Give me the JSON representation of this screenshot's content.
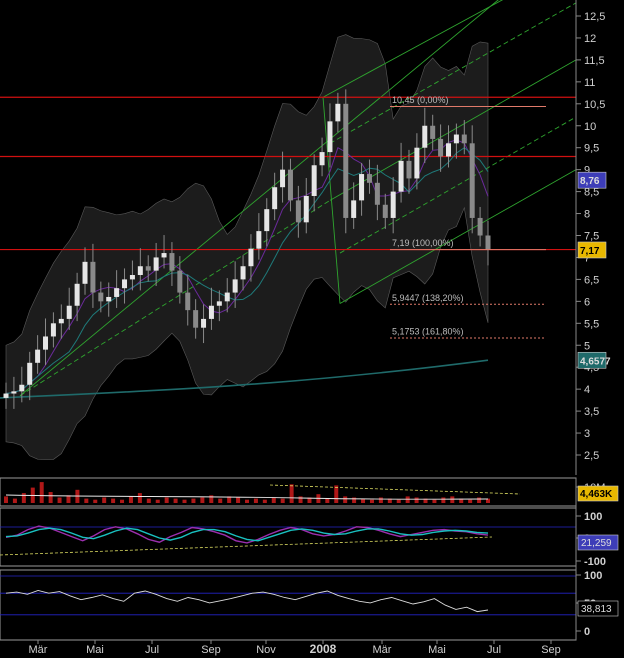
{
  "colors": {
    "background": "#000000",
    "grid": "#2a2a2a",
    "candle_up": "#e6e6e6",
    "candle_down": "#8a8a8a",
    "band_fill": "#1c1c1c",
    "hline": "#d11010",
    "channel": "#2fa52f",
    "fib_label": "#bdbdbd",
    "fib_line": "#e07a6a",
    "volume_bar": "#b01818",
    "volume_line": "#e8e8e8",
    "stoch_k": "#9b2fae",
    "stoch_d": "#19c0c0",
    "rsi_line": "#dcdcdc",
    "ref_line": "#2424c8",
    "axis_text": "#d0d0d0"
  },
  "chart_data": [
    {
      "type": "candlestick",
      "panel": "price",
      "x_axis": {
        "labels": [
          "Mär",
          "Mai",
          "Jul",
          "Sep",
          "Nov",
          "2008",
          "Mär",
          "Mai",
          "Jul",
          "Sep"
        ],
        "bold": [
          "2008"
        ]
      },
      "y_axis": {
        "ticks": [
          "12,5",
          "12",
          "11,5",
          "11",
          "10,5",
          "10",
          "9,5",
          "9",
          "8,5",
          "8",
          "7,5",
          "7",
          "6,5",
          "6",
          "5,5",
          "5",
          "4,5",
          "4",
          "3,5",
          "3",
          "2,5"
        ],
        "range": [
          2.2,
          12.8
        ]
      },
      "grid": false,
      "overlays": [
        "bollinger_bands",
        "moving_average_short",
        "moving_average_mid",
        "moving_average_long",
        "pitchfork_channel"
      ],
      "candles_close": [
        3.9,
        3.95,
        4.1,
        4.6,
        4.9,
        5.2,
        5.5,
        5.6,
        5.9,
        6.4,
        6.9,
        6.2,
        6.0,
        6.1,
        6.3,
        6.5,
        6.6,
        6.8,
        6.7,
        7.0,
        7.1,
        6.7,
        6.2,
        5.8,
        5.4,
        5.6,
        5.9,
        6.0,
        6.2,
        6.5,
        6.8,
        7.2,
        7.6,
        8.1,
        8.6,
        9.0,
        8.3,
        7.8,
        8.4,
        9.1,
        9.4,
        10.1,
        10.5,
        7.9,
        8.3,
        8.9,
        8.7,
        8.2,
        7.9,
        8.5,
        9.2,
        8.8,
        9.5,
        10.0,
        9.7,
        9.3,
        9.6,
        9.8,
        9.6,
        7.9,
        7.5,
        7.17
      ],
      "hlines": [
        10.65,
        9.3,
        7.18
      ],
      "fib_levels": [
        {
          "label": "10,45 (0,00%)",
          "value": 10.45
        },
        {
          "label": "7,19 (100,00%)",
          "value": 7.19
        },
        {
          "label": "5,9447 (138,20%)",
          "value": 5.9447
        },
        {
          "label": "5,1753 (161,80%)",
          "value": 5.1753
        }
      ],
      "badges": [
        {
          "text": "8,76",
          "value": 8.76,
          "color": "#3d3db8"
        },
        {
          "text": "7,17",
          "value": 7.17,
          "color": "#e8b800"
        },
        {
          "text": "4,6577",
          "value": 4.6577,
          "color": "#1f6a6a"
        }
      ]
    },
    {
      "type": "bar",
      "panel": "volume",
      "badge": {
        "text": "4,463K",
        "color": "#e8b800"
      },
      "y_ticks": [
        "10M"
      ],
      "values": [
        0.6,
        0.4,
        0.9,
        1.4,
        1.9,
        1.0,
        0.5,
        0.7,
        1.2,
        0.4,
        0.3,
        0.5,
        0.4,
        0.3,
        0.6,
        0.9,
        0.4,
        0.3,
        0.5,
        0.4,
        0.3,
        0.4,
        0.5,
        0.7,
        0.4,
        0.6,
        0.5,
        0.3,
        0.4,
        0.3,
        0.5,
        0.4,
        1.7,
        0.6,
        0.5,
        0.8,
        0.4,
        1.6,
        0.6,
        0.5,
        0.4,
        0.3,
        0.5,
        0.4,
        0.3,
        0.6,
        0.5,
        0.4,
        0.3,
        0.5,
        0.6,
        0.4,
        0.3,
        0.5,
        0.4
      ]
    },
    {
      "type": "line",
      "panel": "stochastic",
      "badge": {
        "text": "21,259",
        "color": "#3d3db8"
      },
      "y_ticks": [
        "100",
        "0",
        "-100"
      ],
      "y_range": [
        -110,
        110
      ],
      "series_k": [
        5,
        20,
        60,
        85,
        70,
        40,
        10,
        -20,
        15,
        60,
        80,
        65,
        30,
        -10,
        -30,
        10,
        40,
        75,
        65,
        45,
        20,
        -20,
        -35,
        -10,
        25,
        55,
        75,
        60,
        30,
        15,
        25,
        50,
        80,
        75,
        55,
        30,
        10,
        25,
        40,
        55,
        60,
        50,
        45,
        30,
        21
      ],
      "series_d": [
        10,
        15,
        35,
        60,
        70,
        60,
        35,
        5,
        -5,
        20,
        50,
        70,
        60,
        30,
        0,
        -15,
        5,
        40,
        60,
        60,
        45,
        15,
        -10,
        -20,
        5,
        30,
        55,
        65,
        55,
        35,
        25,
        30,
        50,
        65,
        65,
        50,
        30,
        20,
        25,
        40,
        50,
        55,
        50,
        40,
        35
      ],
      "trend_line": [
        -30,
        40
      ]
    },
    {
      "type": "line",
      "panel": "rsi",
      "badge": {
        "text": "38,813",
        "color": "#000000"
      },
      "y_ticks": [
        "100",
        "50",
        "0"
      ],
      "y_range": [
        -15,
        115
      ],
      "ref_levels": [
        70,
        30
      ],
      "values": [
        70,
        72,
        68,
        75,
        70,
        73,
        65,
        58,
        62,
        67,
        60,
        55,
        70,
        74,
        68,
        60,
        55,
        62,
        58,
        52,
        56,
        60,
        65,
        70,
        72,
        68,
        62,
        58,
        64,
        70,
        74,
        66,
        60,
        55,
        52,
        58,
        62,
        56,
        50,
        54,
        60,
        48,
        40,
        44,
        36,
        38.8
      ]
    }
  ]
}
